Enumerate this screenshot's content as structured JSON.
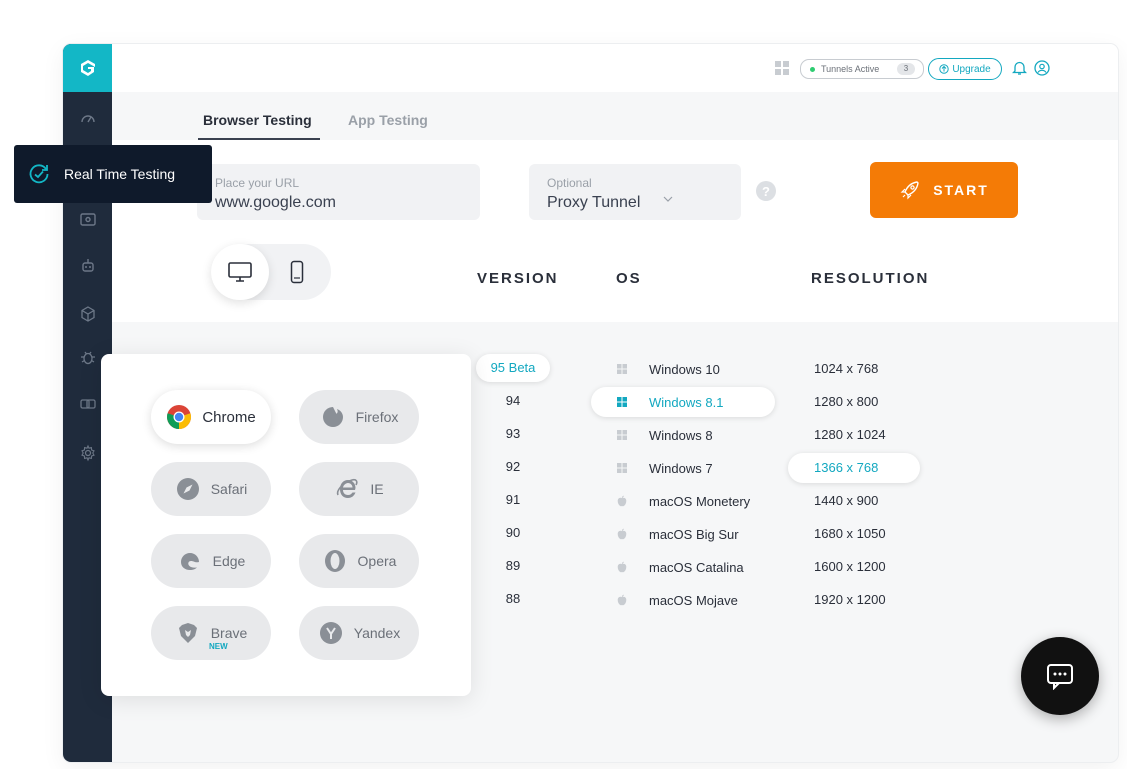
{
  "tooltip": {
    "label": "Real Time Testing",
    "icon": "realtime-icon"
  },
  "header": {
    "tunnels_label": "Tunnels Active",
    "tunnels_count": "3",
    "upgrade_label": "Upgrade",
    "icons": [
      "grid-icon",
      "bell-icon",
      "user-icon"
    ]
  },
  "tabs": [
    {
      "label": "Browser Testing",
      "active": true
    },
    {
      "label": "App Testing",
      "active": false
    }
  ],
  "url_field": {
    "label": "Place your URL",
    "value": "www.google.com"
  },
  "proxy_field": {
    "label": "Optional",
    "value": "Proxy Tunnel"
  },
  "help_glyph": "?",
  "start_button": {
    "label": "START",
    "color": "#f47b06"
  },
  "columns": {
    "version": "VERSION",
    "os": "OS",
    "resolution": "RESOLUTION"
  },
  "versions": [
    "95 Beta",
    "94",
    "93",
    "92",
    "91",
    "90",
    "89",
    "88"
  ],
  "selected_version": "95 Beta",
  "os_list": [
    {
      "name": "Windows 10",
      "icon": "windows-icon"
    },
    {
      "name": "Windows 8.1",
      "icon": "windows-icon"
    },
    {
      "name": "Windows 8",
      "icon": "windows-icon"
    },
    {
      "name": "Windows 7",
      "icon": "windows-icon"
    },
    {
      "name": "macOS Monetery",
      "icon": "apple-icon"
    },
    {
      "name": "macOS Big Sur",
      "icon": "apple-icon"
    },
    {
      "name": "macOS Catalina",
      "icon": "apple-icon"
    },
    {
      "name": "macOS Mojave",
      "icon": "apple-icon"
    }
  ],
  "selected_os": "Windows 8.1",
  "resolutions": [
    "1024 x 768",
    "1280 x 800",
    "1280 x 1024",
    "1366 x 768",
    "1440 x 900",
    "1680 x 1050",
    "1600 x 1200",
    "1920 x 1200"
  ],
  "selected_resolution": "1366 x 768",
  "browsers": [
    {
      "name": "Chrome",
      "icon": "chrome-icon",
      "selected": true
    },
    {
      "name": "Firefox",
      "icon": "firefox-icon"
    },
    {
      "name": "Safari",
      "icon": "safari-icon"
    },
    {
      "name": "IE",
      "icon": "ie-icon"
    },
    {
      "name": "Edge",
      "icon": "edge-icon"
    },
    {
      "name": "Opera",
      "icon": "opera-icon"
    },
    {
      "name": "Brave",
      "icon": "brave-icon",
      "badge": "NEW"
    },
    {
      "name": "Yandex",
      "icon": "yandex-icon"
    }
  ],
  "colors": {
    "accent": "#13b7c6",
    "sidebar": "#1f2b3c",
    "start": "#f47b06"
  }
}
